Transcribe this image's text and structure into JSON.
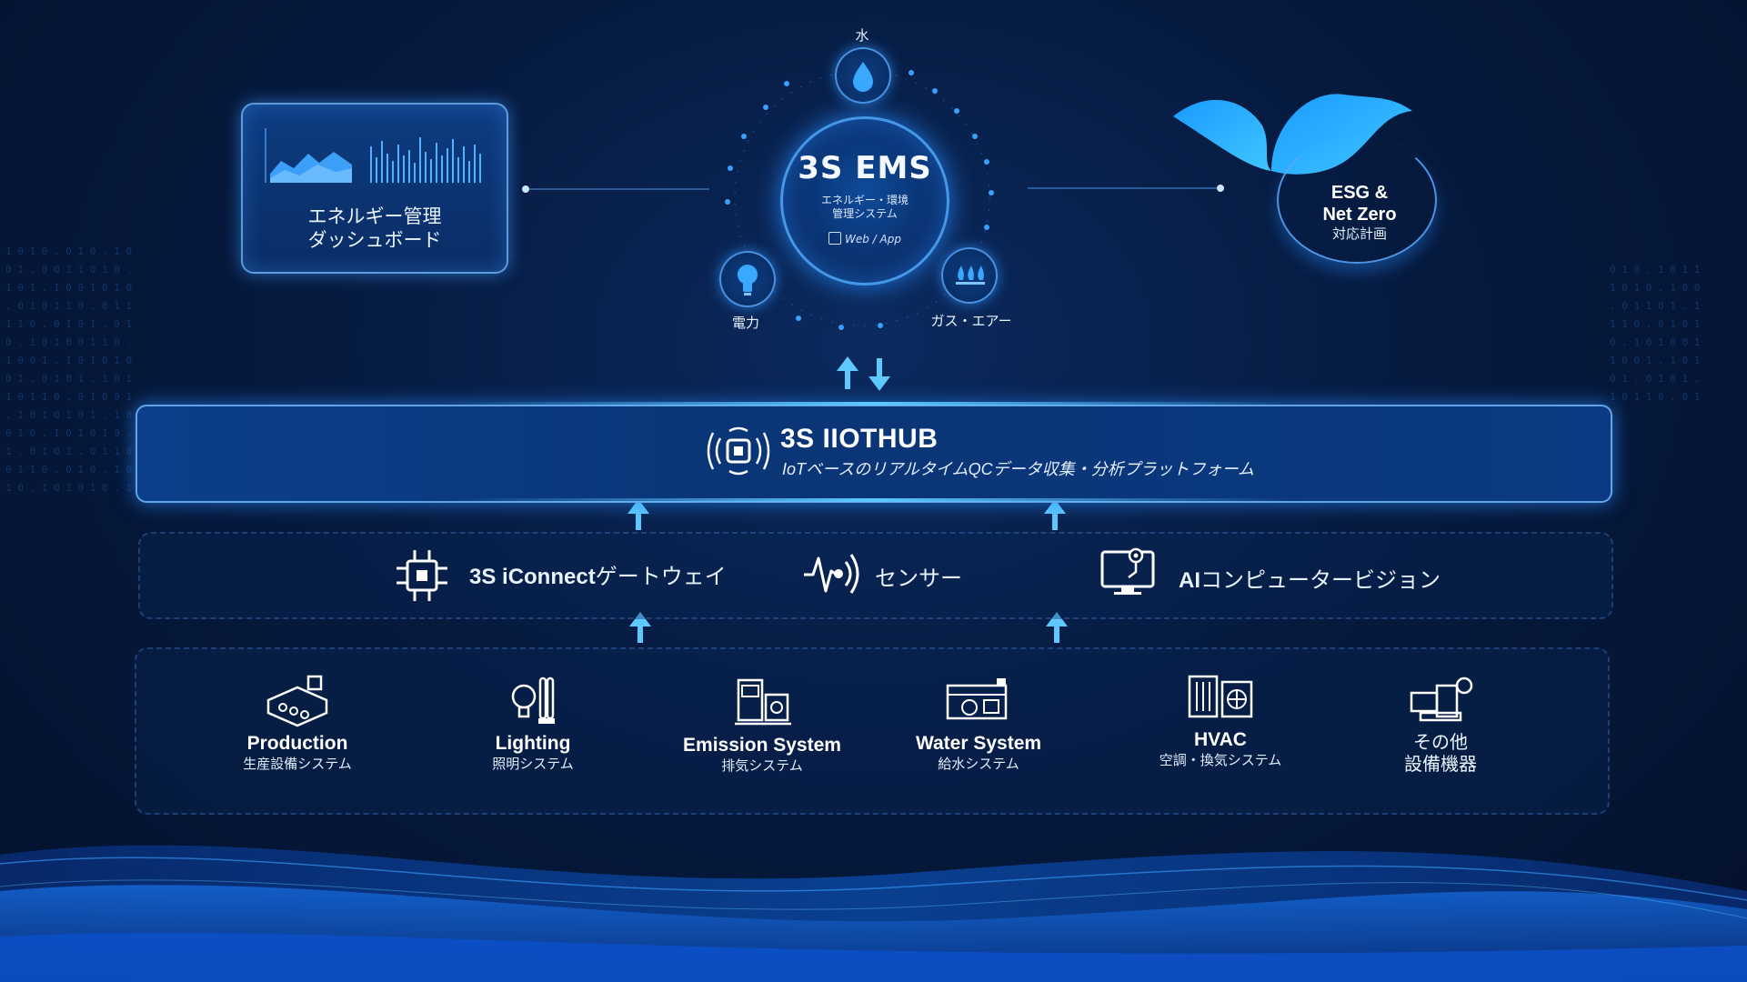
{
  "ems": {
    "title": "3S EMS",
    "subtitle_line1": "エネルギー・環境",
    "subtitle_line2": "管理システム",
    "web_app": "Web / App",
    "node_water": "水",
    "node_power": "電力",
    "node_gas": "ガス・エアー"
  },
  "dashboard": {
    "line1": "エネルギー管理",
    "line2": "ダッシュボード"
  },
  "esg": {
    "line1": "ESG &",
    "line2": "Net Zero",
    "line3": "対応計画"
  },
  "hub": {
    "title": "3S IIOTHUB",
    "subtitle": "IoTベースのリアルタイムQCデータ収集・分析プラットフォーム"
  },
  "gateway_row": {
    "gateway_bold": "3S iConnect",
    "gateway_rest": "ゲートウェイ",
    "sensor": "センサー",
    "ai_bold": "AI",
    "ai_rest": "コンピュータービジョン"
  },
  "equipment": [
    {
      "en": "Production",
      "jp": "生産設備システム"
    },
    {
      "en": "Lighting",
      "jp": "照明システム"
    },
    {
      "en": "Emission System",
      "jp": "排気システム"
    },
    {
      "en": "Water System",
      "jp": "給水システム"
    },
    {
      "en": "HVAC",
      "jp": "空調・換気システム"
    },
    {
      "jp_line1": "その他",
      "jp_line2": "設備機器"
    }
  ],
  "colors": {
    "background": "#061a3f",
    "accent": "#3aa0ff",
    "glow": "#5ec8ff"
  }
}
